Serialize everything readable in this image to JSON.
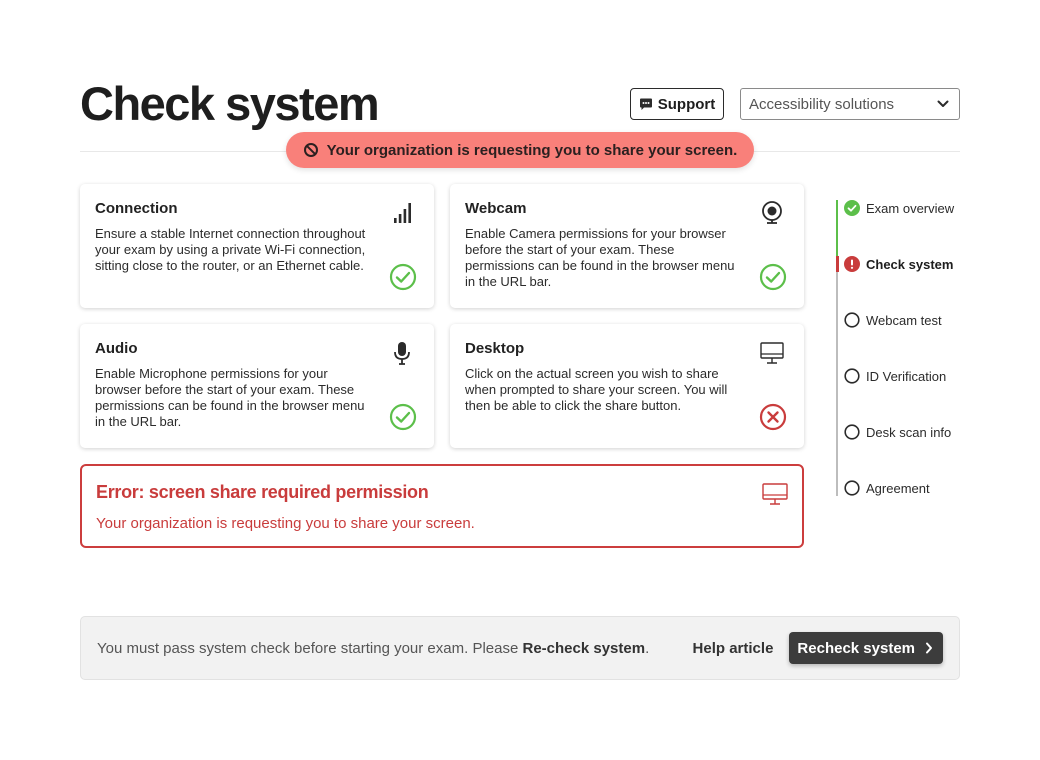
{
  "header": {
    "title": "Check system",
    "support_label": "Support",
    "accessibility_value": "Accessibility solutions"
  },
  "toast": {
    "message": "Your organization is requesting you to share your screen."
  },
  "checks": [
    {
      "title": "Connection",
      "description": "Ensure a stable Internet connection throughout your exam by using a private Wi-Fi connection, sitting close to the router, or an Ethernet cable.",
      "icon": "signal-icon",
      "status": "pass"
    },
    {
      "title": "Webcam",
      "description": "Enable Camera permissions for your browser before the start of your exam. These permissions can be found in the browser menu in the URL bar.",
      "icon": "webcam-icon",
      "status": "pass"
    },
    {
      "title": "Audio",
      "description": "Enable Microphone permissions for your browser before the start of your exam. These permissions can be found in the browser menu in the URL bar.",
      "icon": "microphone-icon",
      "status": "pass"
    },
    {
      "title": "Desktop",
      "description": "Click on the actual screen you wish to share when prompted to share your screen. You will then be able to click the share button.",
      "icon": "desktop-icon",
      "status": "fail"
    }
  ],
  "error": {
    "title": "Error: screen share required permission",
    "message": "Your organization is requesting you to share your screen."
  },
  "steps": [
    {
      "label": "Exam overview",
      "state": "complete"
    },
    {
      "label": "Check system",
      "state": "error"
    },
    {
      "label": "Webcam test",
      "state": "pending"
    },
    {
      "label": "ID Verification",
      "state": "pending"
    },
    {
      "label": "Desk scan info",
      "state": "pending"
    },
    {
      "label": "Agreement",
      "state": "pending"
    }
  ],
  "footer": {
    "message_prefix": "You must pass system check before starting your exam. Please ",
    "message_bold": "Re-check system",
    "message_suffix": ".",
    "help_label": "Help article",
    "recheck_label": "Recheck system"
  },
  "colors": {
    "success": "#5cbf4a",
    "error": "#c93c3c",
    "toast_bg": "#f9807a",
    "button_dark": "#3c3c3c"
  }
}
